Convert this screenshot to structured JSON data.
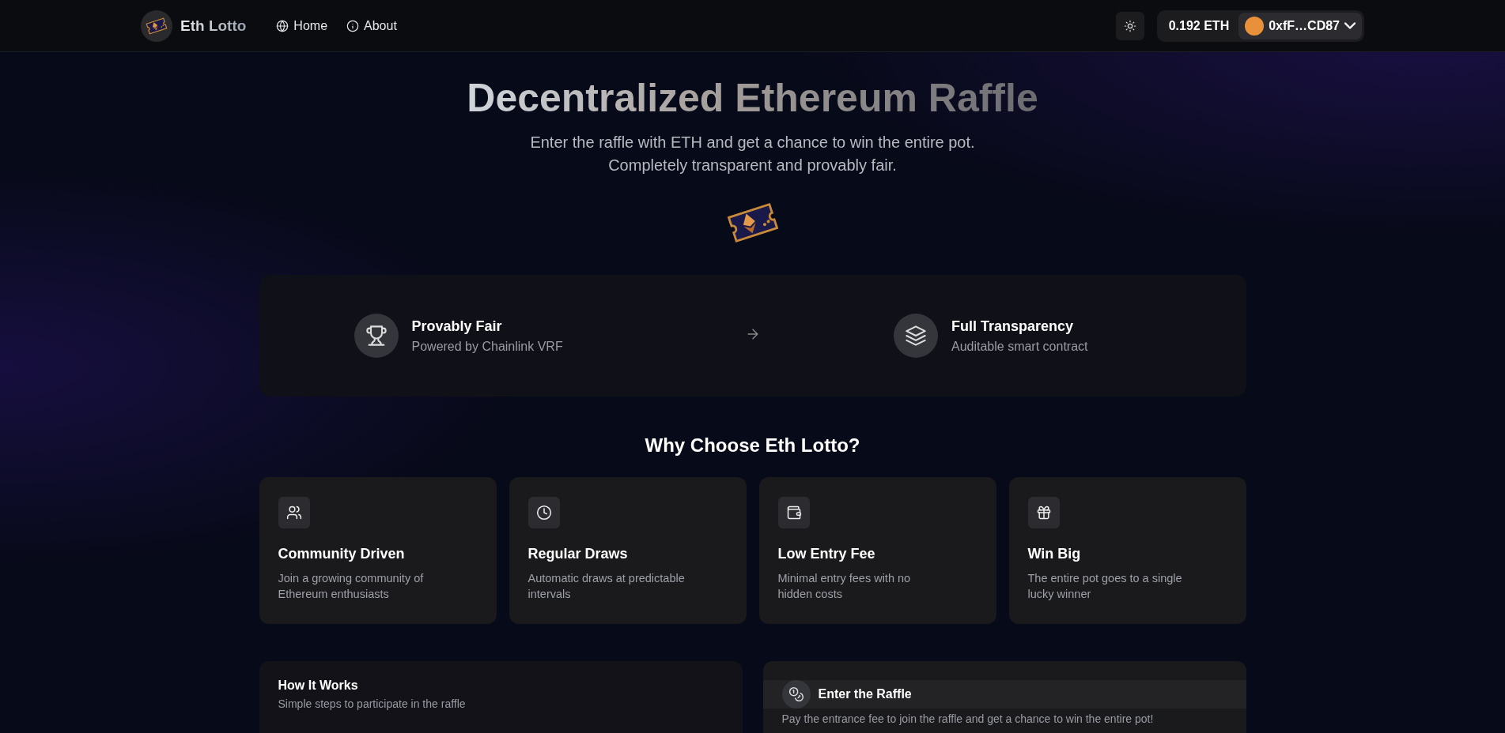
{
  "header": {
    "brand": "Eth Lotto",
    "nav": [
      {
        "label": "Home",
        "kind": "globe"
      },
      {
        "label": "About",
        "kind": "info"
      }
    ],
    "balance": "0.192 ETH",
    "account": "0xfF…CD87"
  },
  "hero": {
    "title": "Decentralized Ethereum Raffle",
    "subtitle_lines": [
      "Enter the raffle with ETH and get a chance to win the entire pot.",
      "Completely transparent and provably fair."
    ]
  },
  "highlights": [
    {
      "title": "Provably Fair",
      "subtitle": "Powered by Chainlink VRF",
      "kind": "trophy"
    },
    {
      "title": "Full Transparency",
      "subtitle": "Auditable smart contract",
      "kind": "layers"
    }
  ],
  "why": {
    "heading": "Why Choose Eth Lotto?",
    "cards": [
      {
        "title": "Community Driven",
        "text": "Join a growing community of Ethereum enthusiasts",
        "kind": "users"
      },
      {
        "title": "Regular Draws",
        "text": "Automatic draws at predictable intervals",
        "kind": "clock"
      },
      {
        "title": "Low Entry Fee",
        "text": "Minimal entry fees with no hidden costs",
        "kind": "wallet"
      },
      {
        "title": "Win Big",
        "text": "The entire pot goes to a single lucky winner",
        "kind": "gift"
      }
    ]
  },
  "how_it_works": {
    "title": "How It Works",
    "subtitle": "Simple steps to participate in the raffle"
  },
  "enter_raffle": {
    "title": "Enter the Raffle",
    "description": "Pay the entrance fee to join the raffle and get a chance to win the entire pot!"
  }
}
